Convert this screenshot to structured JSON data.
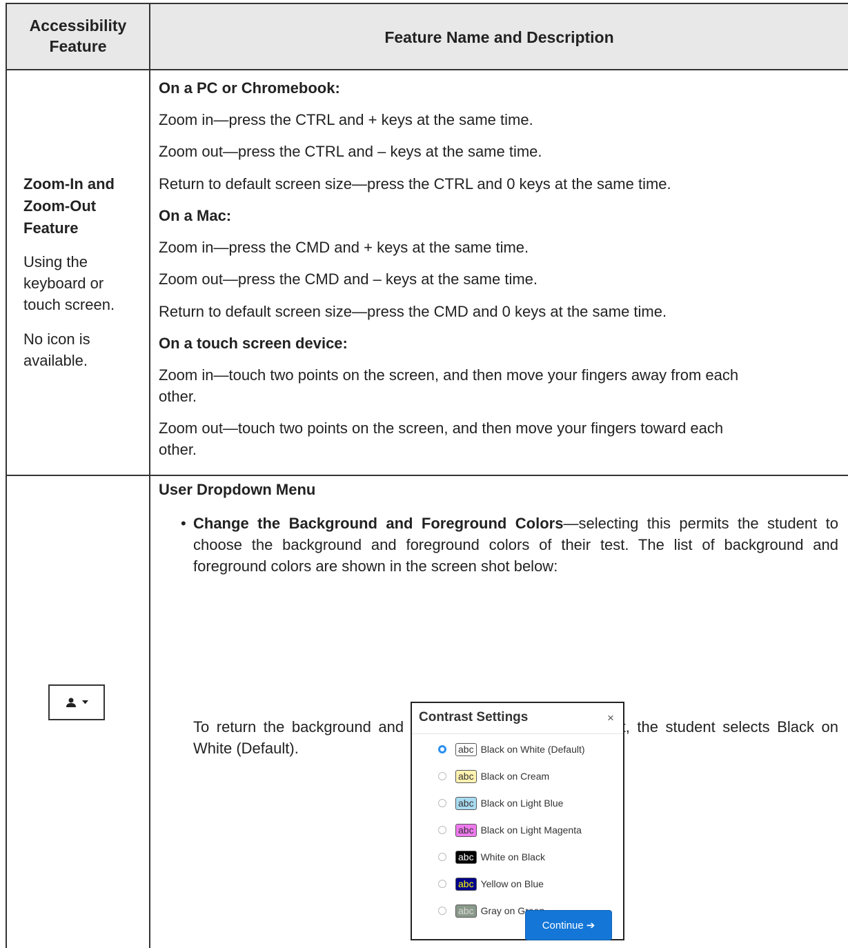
{
  "header": {
    "col1": "Accessibility Feature",
    "col2": "Feature Name and Description"
  },
  "zoom_row": {
    "feature_title": "Zoom-In and Zoom-Out Feature",
    "feature_desc1": "Using the keyboard or touch screen.",
    "feature_desc2": "No icon is available.",
    "pc_heading": "On a PC or Chromebook:",
    "pc_zoom_in": "Zoom in—press the CTRL and + keys at the same time.",
    "pc_zoom_out": "Zoom out—press the CTRL and – keys at the same time.",
    "pc_default": "Return to default screen size—press the CTRL and 0 keys at the same time.",
    "mac_heading": "On a Mac:",
    "mac_zoom_in": "Zoom in—press the CMD and + keys at the same time.",
    "mac_zoom_out": "Zoom out—press the CMD and – keys at the same time.",
    "mac_default": "Return to default screen size—press the CMD and 0 keys at the same time.",
    "touch_heading": "On a touch screen device:",
    "touch_zoom_in_1": "Zoom in—touch two points on the screen, and then move your fingers away from each",
    "touch_zoom_in_2": "other.",
    "touch_zoom_out_1": "Zoom out—touch two points on the screen, and then move your fingers toward each",
    "touch_zoom_out_2": "other."
  },
  "user_row": {
    "heading": "User Dropdown Menu",
    "bullet_bold": "Change the Background and Foreground Colors",
    "bullet_text": "—selecting this permits the student to choose the background and foreground colors of their test. The list of background and foreground colors are shown in the screen shot below:",
    "closing_text": "To return the background and foreground color to the default, the student selects Black on White (Default)."
  },
  "dialog": {
    "title": "Contrast Settings",
    "close_symbol": "×",
    "abc": "abc",
    "options": [
      {
        "label": "Black on White (Default)",
        "bg": "#ffffff",
        "fg": "#333333",
        "selected": true
      },
      {
        "label": "Black on Cream",
        "bg": "#fff3b0",
        "fg": "#333333",
        "selected": false
      },
      {
        "label": "Black on Light Blue",
        "bg": "#a9dcf2",
        "fg": "#333333",
        "selected": false
      },
      {
        "label": "Black on Light Magenta",
        "bg": "#ee7aee",
        "fg": "#333333",
        "selected": false
      },
      {
        "label": "White on Black",
        "bg": "#000000",
        "fg": "#ffffff",
        "selected": false
      },
      {
        "label": "Yellow on Blue",
        "bg": "#00008b",
        "fg": "#ffff00",
        "selected": false
      },
      {
        "label": "Gray on Green",
        "bg": "#8a9a8a",
        "fg": "#d8d8d8",
        "selected": false
      }
    ],
    "continue_label": "Continue",
    "continue_arrow": "➔"
  },
  "icons": {
    "user_menu": "user-dropdown-icon"
  }
}
